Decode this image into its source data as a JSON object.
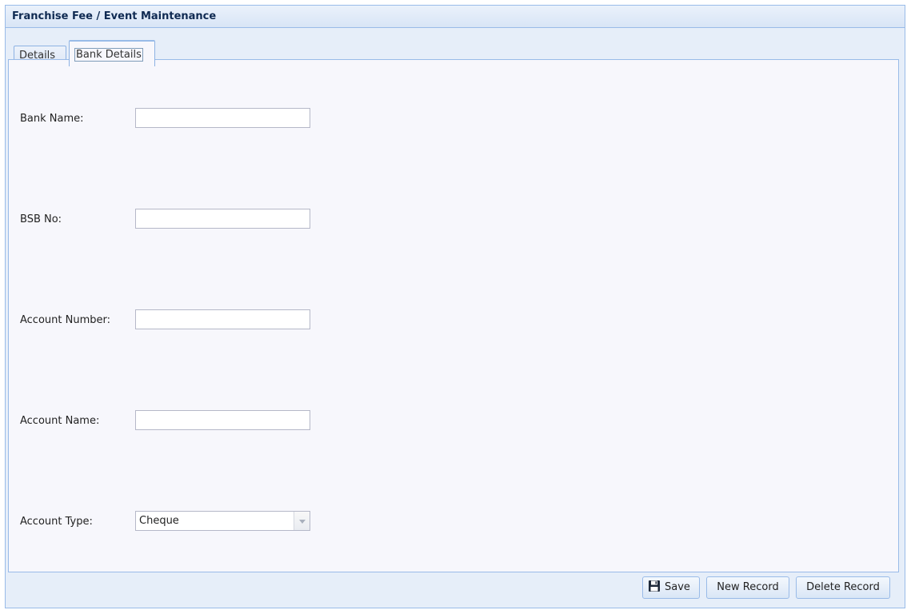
{
  "window": {
    "title": "Franchise Fee / Event Maintenance"
  },
  "tabs": [
    {
      "label": "Details",
      "active": false
    },
    {
      "label": "Bank Details",
      "active": true
    }
  ],
  "form": {
    "bank_name": {
      "label": "Bank Name:",
      "value": ""
    },
    "bsb_no": {
      "label": "BSB No:",
      "value": ""
    },
    "account_number": {
      "label": "Account Number:",
      "value": ""
    },
    "account_name": {
      "label": "Account Name:",
      "value": ""
    },
    "account_type": {
      "label": "Account Type:",
      "value": "Cheque"
    }
  },
  "toolbar": {
    "save_label": "Save",
    "new_record_label": "New Record",
    "delete_record_label": "Delete Record",
    "save_icon": "floppy-disk-icon"
  },
  "colors": {
    "accent_border": "#99bbe8",
    "title_text": "#0f2a52",
    "panel_bg": "#f7f7fc"
  }
}
